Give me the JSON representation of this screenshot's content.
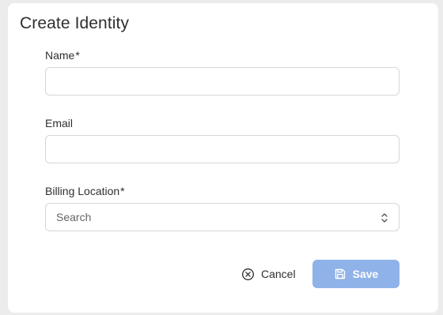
{
  "dialog": {
    "title": "Create Identity"
  },
  "form": {
    "name": {
      "label": "Name",
      "required_marker": "*",
      "value": ""
    },
    "email": {
      "label": "Email",
      "value": ""
    },
    "billing_location": {
      "label": "Billing Location",
      "required_marker": "*",
      "placeholder": "Search"
    }
  },
  "actions": {
    "cancel_label": "Cancel",
    "save_label": "Save"
  },
  "colors": {
    "primary_disabled": "#8fb2e9",
    "border": "#d6d6d6",
    "text": "#2f2f2f"
  },
  "icons": {
    "cancel": "circle-x-icon",
    "save": "floppy-disk-icon",
    "select": "chevron-up-down-icon"
  }
}
